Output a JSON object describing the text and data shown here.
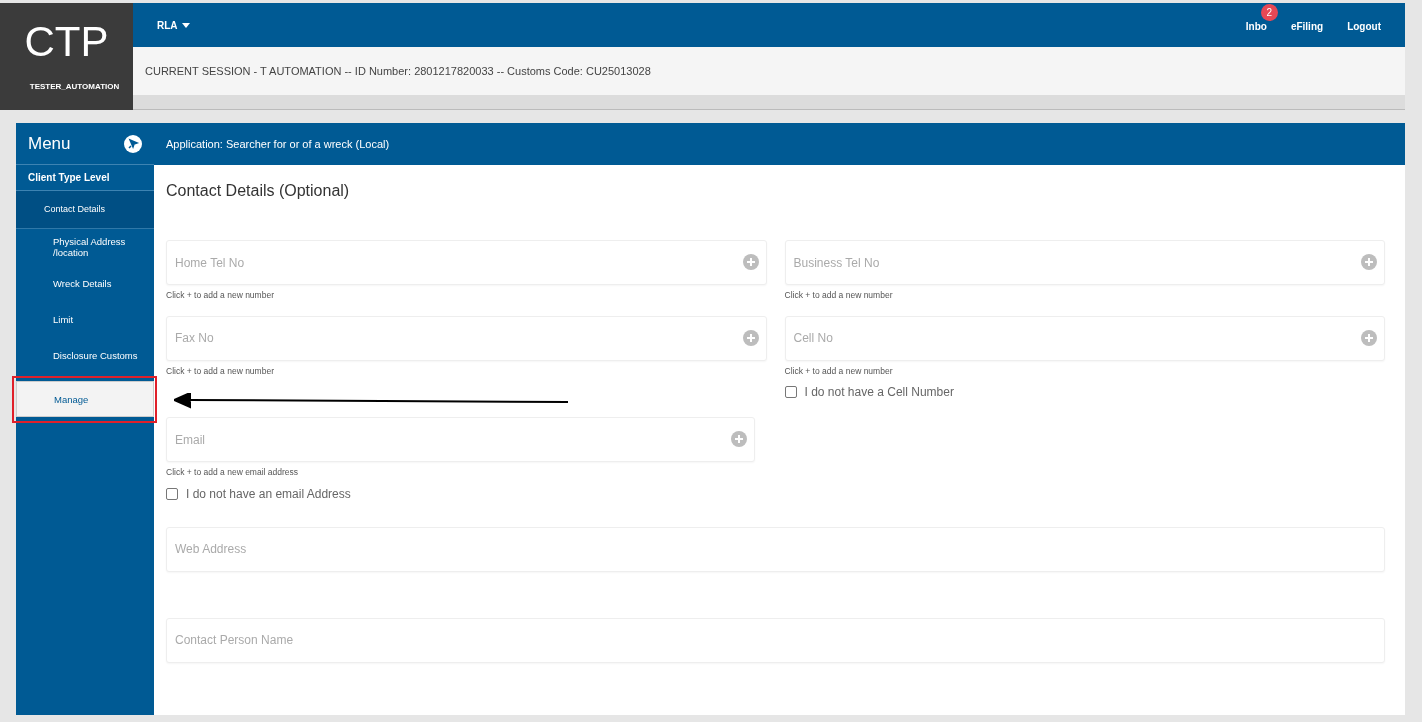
{
  "logo": {
    "title": "CTP",
    "user": "TESTER_AUTOMATION"
  },
  "top_nav": {
    "menu": "RLA",
    "links": [
      {
        "label": "Inbo",
        "badge": "2"
      },
      {
        "label": "eFiling"
      },
      {
        "label": "Logout"
      }
    ]
  },
  "session": "CURRENT SESSION - T AUTOMATION -- ID Number: 2801217820033 -- Customs Code: CU25013028",
  "sidebar": {
    "title": "Menu",
    "items": [
      {
        "label": "Client Type Level",
        "selected": false,
        "children": [
          {
            "label": "Contact Details",
            "selected": false,
            "children": [
              {
                "label": "Physical Address /location",
                "selected": false
              },
              {
                "label": "Wreck Details",
                "selected": false
              },
              {
                "label": "Limit",
                "selected": false
              },
              {
                "label": "Disclosure Customs",
                "selected": false
              },
              {
                "label": "Manage",
                "selected": true
              }
            ]
          }
        ]
      }
    ]
  },
  "application": "Application: Searcher for or of a wreck (Local)",
  "section_title": "Contact Details (Optional)",
  "fields": [
    {
      "kind": "pair",
      "items": [
        {
          "placeholder": "Home Tel No",
          "hint": "Click + to add a new number"
        },
        {
          "placeholder": "Business Tel No",
          "hint": "Click + to add a new number"
        }
      ]
    },
    {
      "kind": "pair",
      "items": [
        {
          "placeholder": "Fax No",
          "hint": "Click + to add a new number"
        },
        {
          "placeholder": "Cell No",
          "hint": "Click + to add a new number",
          "checkbox": {
            "label": "I do not have a Cell Number",
            "checked": false
          }
        }
      ]
    },
    {
      "kind": "half",
      "placeholder": "Email",
      "hint": "Click + to add a new email address",
      "checkbox": {
        "label": "I do not have an email Address",
        "checked": false
      }
    },
    {
      "kind": "full",
      "placeholder": "Web Address"
    },
    {
      "kind": "full",
      "placeholder": "Contact Person Name"
    }
  ]
}
